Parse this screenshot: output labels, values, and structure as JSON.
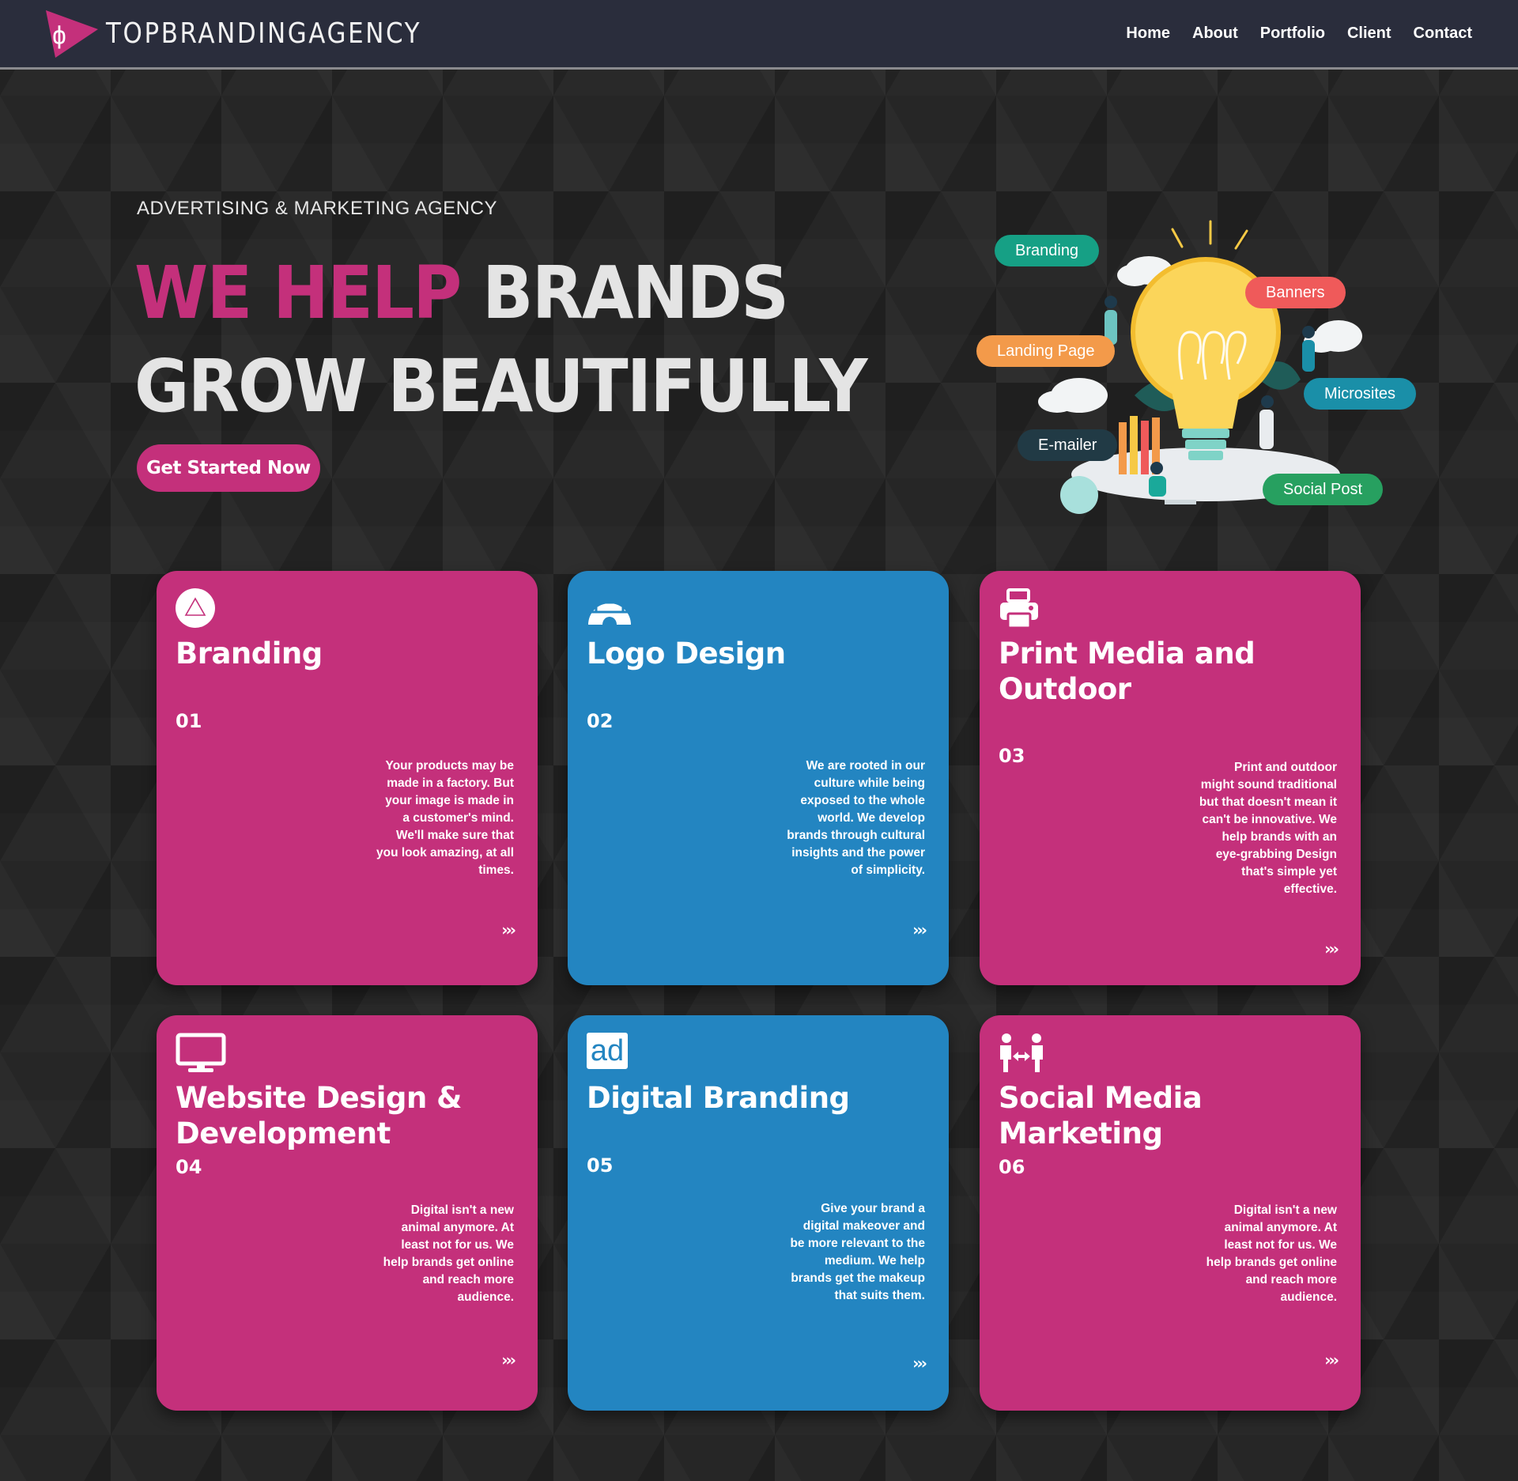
{
  "nav": {
    "brand": "TOPBRANDINGAGENCY",
    "links": [
      "Home",
      "About",
      "Portfolio",
      "Client",
      "Contact"
    ]
  },
  "hero": {
    "eyebrow": "ADVERTISING & MARKETING AGENCY",
    "title_accent": "WE HELP",
    "title_rest": " BRANDS",
    "title_line2": "GROW BEAUTIFULLY",
    "cta": "Get Started Now"
  },
  "illustration_tags": [
    {
      "label": "Branding",
      "color": "#16a085"
    },
    {
      "label": "Banners",
      "color": "#ef5a5a"
    },
    {
      "label": "Landing Page",
      "color": "#f39a4a"
    },
    {
      "label": "Microsites",
      "color": "#1a8fa8"
    },
    {
      "label": "E-mailer",
      "color": "#213a45"
    },
    {
      "label": "Social Post",
      "color": "#27a060"
    }
  ],
  "services": [
    {
      "icon": "branding-icon",
      "title": "Branding",
      "number": "01",
      "desc": "Your products may be made in a factory. But your image is made in a customer's mind. We'll make sure that you look amazing, at all times.",
      "more": "›››",
      "color": "#c4307b"
    },
    {
      "icon": "igloo-icon",
      "title": "Logo Design",
      "number": "02",
      "desc": "We are rooted in our culture while being exposed to the whole world. We develop brands through cultural insights and the power of simplicity.",
      "more": "›››",
      "color": "#2385c1"
    },
    {
      "icon": "printer-icon",
      "title": "Print Media and Outdoor",
      "number": "03",
      "desc": "Print and outdoor might sound traditional but that doesn't mean it can't be innovative. We help brands with an eye-grabbing Design that's simple yet effective.",
      "more": "›››",
      "color": "#c4307b"
    },
    {
      "icon": "monitor-icon",
      "title": "Website Design & Development",
      "number": "04",
      "desc": "Digital isn't a new animal anymore. At least not for us. We help brands get online and reach more audience.",
      "more": "›››",
      "color": "#c4307b"
    },
    {
      "icon": "ad-icon",
      "title": "Digital Branding",
      "number": "05",
      "icon_text": "ad",
      "desc": "Give your brand a digital makeover and be more relevant to the medium. We help brands get the makeup that suits them.",
      "more": "›››",
      "color": "#2385c1"
    },
    {
      "icon": "people-arrows-icon",
      "title": "Social Media Marketing",
      "number": "06",
      "desc": "Digital isn't a new animal anymore. At least not for us. We help brands get online and reach more audience.",
      "more": "›››",
      "color": "#c4307b"
    }
  ]
}
